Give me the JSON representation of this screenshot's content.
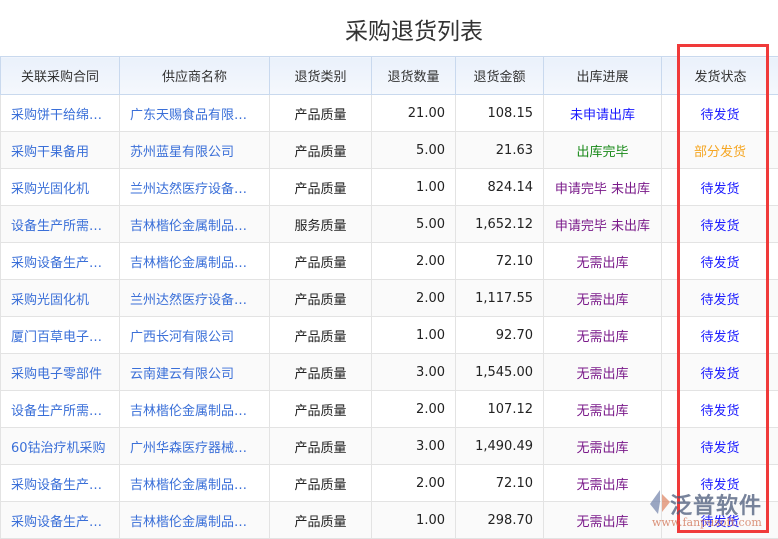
{
  "title": "采购退货列表",
  "headers": [
    "关联采购合同",
    "供应商名称",
    "退货类别",
    "退货数量",
    "退货金额",
    "出库进展",
    "发货状态"
  ],
  "colors": {
    "link": "#3a6fd8",
    "blue": "#1a1aff",
    "green": "#1a8a1a",
    "purple": "#7a1a8a",
    "orange": "#f5a623"
  },
  "rows": [
    {
      "contract": "采购饼干给绵阳分公司",
      "supplier": "广东天赐食品有限公司",
      "category": "产品质量",
      "qty": "21.00",
      "amount": "108.15",
      "progress": "未申请出库",
      "pc": "blue",
      "status": "待发货",
      "sc": "blue"
    },
    {
      "contract": "采购干果备用",
      "supplier": "苏州蓝星有限公司",
      "category": "产品质量",
      "qty": "5.00",
      "amount": "21.63",
      "progress": "出库完毕",
      "pc": "green",
      "status": "部分发货",
      "sc": "orange"
    },
    {
      "contract": "采购光固化机",
      "supplier": "兰州达然医疗设备有限公司",
      "category": "产品质量",
      "qty": "1.00",
      "amount": "824.14",
      "progress": "申请完毕 未出库",
      "pc": "purple",
      "status": "待发货",
      "sc": "blue"
    },
    {
      "contract": "设备生产所需材料采购",
      "supplier": "吉林楷伦金属制品有限公司",
      "category": "服务质量",
      "qty": "5.00",
      "amount": "1,652.12",
      "progress": "申请完毕 未出库",
      "pc": "purple",
      "status": "待发货",
      "sc": "blue"
    },
    {
      "contract": "采购设备生产材料",
      "supplier": "吉林楷伦金属制品有限公司",
      "category": "产品质量",
      "qty": "2.00",
      "amount": "72.10",
      "progress": "无需出库",
      "pc": "purple",
      "status": "待发货",
      "sc": "blue"
    },
    {
      "contract": "采购光固化机",
      "supplier": "兰州达然医疗设备有限公司",
      "category": "产品质量",
      "qty": "2.00",
      "amount": "1,117.55",
      "progress": "无需出库",
      "pc": "purple",
      "status": "待发货",
      "sc": "blue"
    },
    {
      "contract": "厦门百草电子元件采购",
      "supplier": "广西长河有限公司",
      "category": "产品质量",
      "qty": "1.00",
      "amount": "92.70",
      "progress": "无需出库",
      "pc": "purple",
      "status": "待发货",
      "sc": "blue"
    },
    {
      "contract": "采购电子零部件",
      "supplier": "云南建云有限公司",
      "category": "产品质量",
      "qty": "3.00",
      "amount": "1,545.00",
      "progress": "无需出库",
      "pc": "purple",
      "status": "待发货",
      "sc": "blue"
    },
    {
      "contract": "设备生产所需材料采购",
      "supplier": "吉林楷伦金属制品有限公司",
      "category": "产品质量",
      "qty": "2.00",
      "amount": "107.12",
      "progress": "无需出库",
      "pc": "purple",
      "status": "待发货",
      "sc": "blue"
    },
    {
      "contract": "60钴治疗机采购",
      "supplier": "广州华森医疗器械有限公司",
      "category": "产品质量",
      "qty": "3.00",
      "amount": "1,490.49",
      "progress": "无需出库",
      "pc": "purple",
      "status": "待发货",
      "sc": "blue"
    },
    {
      "contract": "采购设备生产材料",
      "supplier": "吉林楷伦金属制品有限公司",
      "category": "产品质量",
      "qty": "2.00",
      "amount": "72.10",
      "progress": "无需出库",
      "pc": "purple",
      "status": "待发货",
      "sc": "blue"
    },
    {
      "contract": "采购设备生产材料",
      "supplier": "吉林楷伦金属制品有限公司",
      "category": "产品质量",
      "qty": "1.00",
      "amount": "298.70",
      "progress": "无需出库",
      "pc": "purple",
      "status": "待发货",
      "sc": "blue"
    }
  ],
  "watermark": {
    "brand": "泛普软件",
    "url": "www.fanpusoft.com"
  }
}
